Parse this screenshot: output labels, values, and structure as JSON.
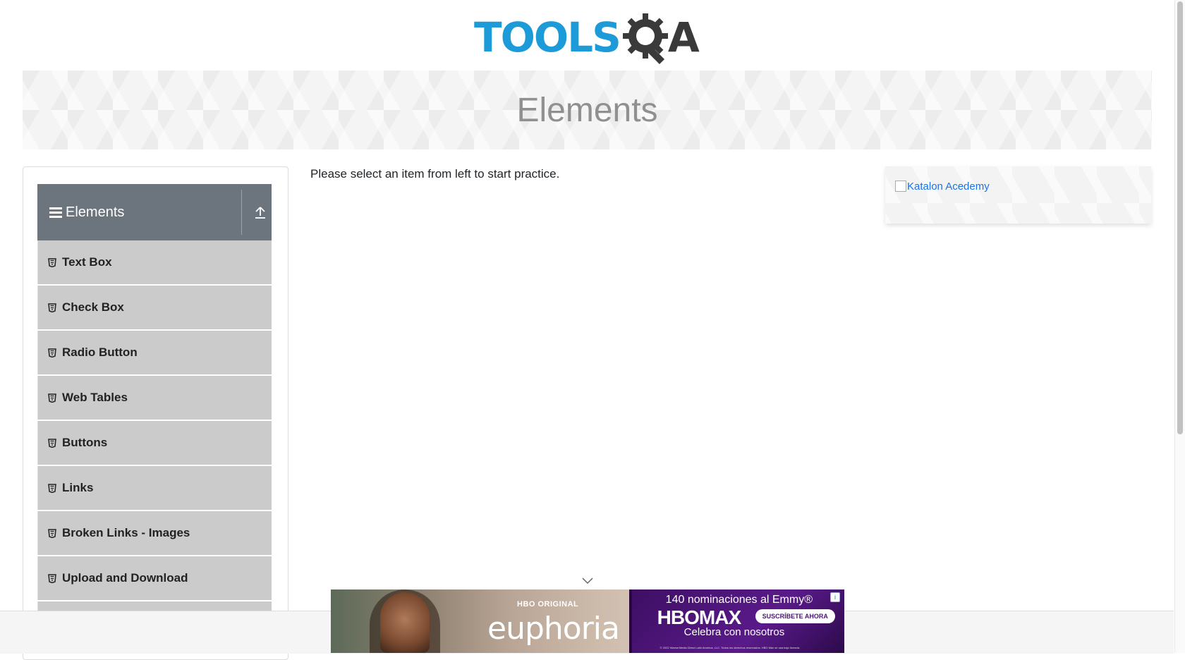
{
  "logo": {
    "tools": "TOOLS",
    "q": "Q",
    "a": "A"
  },
  "banner": {
    "title": "Elements"
  },
  "sidebar": {
    "group_title": "Elements",
    "items": [
      {
        "label": "Text Box"
      },
      {
        "label": "Check Box"
      },
      {
        "label": "Radio Button"
      },
      {
        "label": "Web Tables"
      },
      {
        "label": "Buttons"
      },
      {
        "label": "Links"
      },
      {
        "label": "Broken Links - Images"
      },
      {
        "label": "Upload and Download"
      }
    ]
  },
  "main": {
    "instructions": "Please select an item from left to start practice."
  },
  "right_ad": {
    "image_alt": "Katalon Acedemy"
  },
  "video_ad": {
    "hbo_original": "HBO ORIGINAL",
    "show_title": "euphoria",
    "nominations": "140 nominaciones al Emmy®",
    "brand": "HBOMAX",
    "subscribe": "SUSCRÍBETE AHORA",
    "tagline": "Celebra con nosotros",
    "legal": "© 2022 WarnerMedia Direct Latin America, LLC. Todos los derechos reservados. HBO Max se usa bajo licencia.",
    "info": "i"
  },
  "colors": {
    "brand_blue": "#1d9bd8",
    "header_gray": "#6c757d",
    "menu_item_bg": "#cbcbcb"
  }
}
